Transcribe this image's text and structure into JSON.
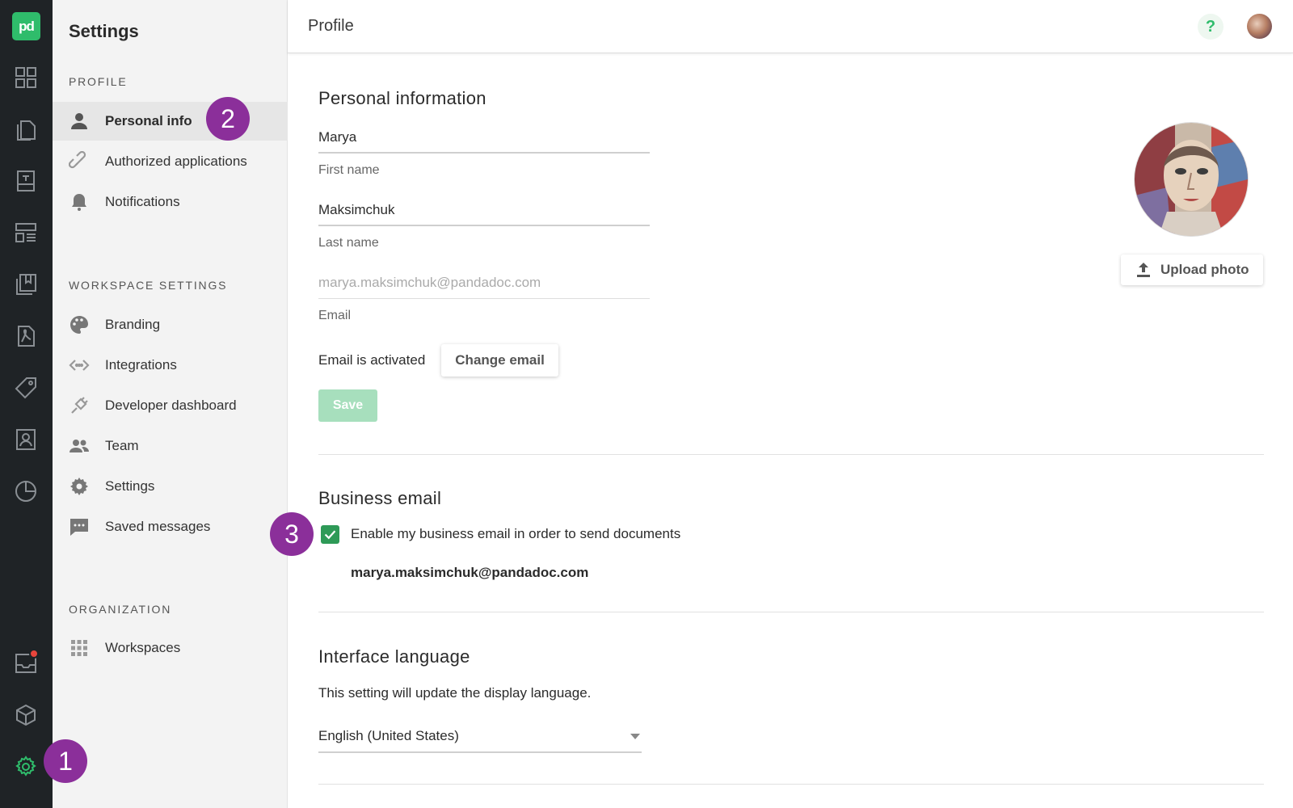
{
  "rail": {
    "logo": "pd",
    "icons": [
      "dashboard-icon",
      "documents-icon",
      "templates-icon",
      "content-library-icon",
      "catalog-icon",
      "forms-icon",
      "pricing-icon",
      "contacts-icon",
      "reports-icon",
      "inbox-icon",
      "integrations-cube-icon",
      "settings-gear-icon"
    ],
    "notification_dot_color": "#e8453c"
  },
  "sidebar": {
    "title": "Settings",
    "sections": [
      {
        "label": "PROFILE",
        "items": [
          {
            "label": "Personal info",
            "icon": "person-icon",
            "active": true
          },
          {
            "label": "Authorized applications",
            "icon": "link-icon"
          },
          {
            "label": "Notifications",
            "icon": "bell-icon"
          }
        ]
      },
      {
        "label": "WORKSPACE SETTINGS",
        "items": [
          {
            "label": "Branding",
            "icon": "palette-icon"
          },
          {
            "label": "Integrations",
            "icon": "code-arrows-icon"
          },
          {
            "label": "Developer dashboard",
            "icon": "plug-icon"
          },
          {
            "label": "Team",
            "icon": "people-icon"
          },
          {
            "label": "Settings",
            "icon": "gear-icon"
          },
          {
            "label": "Saved messages",
            "icon": "chat-icon"
          }
        ]
      },
      {
        "label": "ORGANIZATION",
        "items": [
          {
            "label": "Workspaces",
            "icon": "grid-icon"
          }
        ]
      }
    ]
  },
  "badges": [
    "1",
    "2",
    "3"
  ],
  "header": {
    "title": "Profile",
    "help": "?"
  },
  "personal": {
    "heading": "Personal information",
    "first_name": {
      "value": "Marya",
      "label": "First name"
    },
    "last_name": {
      "value": "Maksimchuk",
      "label": "Last name"
    },
    "email": {
      "value": "marya.maksimchuk@pandadoc.com",
      "label": "Email"
    },
    "email_status": "Email is activated",
    "change_email": "Change email",
    "save": "Save",
    "upload_photo": "Upload photo"
  },
  "business": {
    "heading": "Business email",
    "checkbox_label": "Enable my business email in order to send documents",
    "checked": true,
    "email": "marya.maksimchuk@pandadoc.com"
  },
  "language": {
    "heading": "Interface language",
    "description": "This setting will update the display language.",
    "selected": "English (United States)"
  },
  "colors": {
    "brand_green": "#2fbc6b",
    "badge_purple": "#8b2f9a",
    "rail_bg": "#1f2326"
  }
}
